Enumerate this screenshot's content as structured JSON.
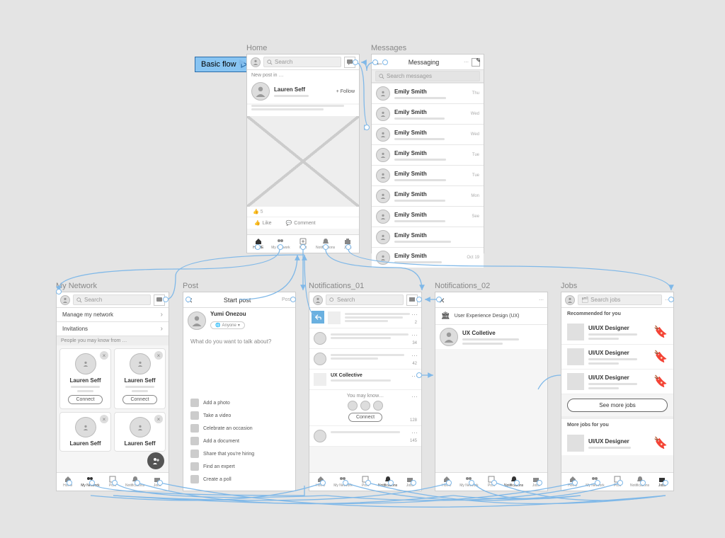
{
  "badge": {
    "label": "Basic flow"
  },
  "screens": {
    "home": {
      "title": "Home",
      "search": "Search",
      "newpost": "New post in …",
      "author": "Lauren Seff",
      "follow": "+ Follow",
      "likes": "5",
      "like": "Like",
      "comment": "Comment"
    },
    "messages": {
      "title": "Messages",
      "header": "Messaging",
      "search": "Search messages",
      "items": [
        {
          "name": "Emily Smith",
          "meta": "Thu"
        },
        {
          "name": "Emily Smith",
          "meta": "Wed"
        },
        {
          "name": "Emily Smith",
          "meta": "Wed"
        },
        {
          "name": "Emily Smith",
          "meta": "Tue"
        },
        {
          "name": "Emily Smith",
          "meta": "Tue"
        },
        {
          "name": "Emily Smith",
          "meta": "Mon"
        },
        {
          "name": "Emily Smith",
          "meta": "See"
        },
        {
          "name": "Emily Smith",
          "meta": ""
        },
        {
          "name": "Emily Smith",
          "meta": "Oct 19"
        }
      ]
    },
    "network": {
      "title": "My Network",
      "search": "Search",
      "manage": "Manage my network",
      "invitations": "Invitations",
      "pymk": "People you may know from …",
      "cards": [
        "Lauren Seff",
        "Lauren Seff",
        "Lauren Seff",
        "Lauren Seff"
      ],
      "connect": "Connect"
    },
    "post": {
      "title": "Post",
      "close": "×",
      "header": "Start post",
      "postBtn": "Post",
      "author": "Yumi Onezou",
      "audience": "Anyone",
      "prompt": "What do you want to talk about?",
      "actions": [
        "Add a photo",
        "Take a video",
        "Celebrate an occasion",
        "Add a document",
        "Share that you're hiring",
        "Find an expert",
        "Create a poll"
      ]
    },
    "notif1": {
      "title": "Notifications_01",
      "search": "Search",
      "uxcollective": "UX Collective",
      "pymk": "You may know…",
      "connect": "Connect",
      "counts": [
        "2",
        "34",
        "42",
        "",
        "128",
        "",
        "145"
      ]
    },
    "notif2": {
      "title": "Notifications_02",
      "category": "User Experience Design (UX)",
      "item": "UX Colletive"
    },
    "jobs": {
      "title": "Jobs",
      "search": "Search jobs",
      "recommended": "Recommended for you",
      "role": "UI/UX Designer",
      "seemore": "See more jobs",
      "more": "More jobs for you"
    }
  },
  "tabs": {
    "home": [
      "HOME",
      "My Network",
      "Post",
      "Notifications",
      "Jobs"
    ],
    "network": [
      "Home",
      "My Network",
      "Post",
      "Notifications",
      "Jobs"
    ],
    "notif": [
      "Home",
      "My Network",
      "Post",
      "Notifications",
      "Jobs"
    ],
    "jobs": [
      "Home",
      "My Network",
      "Post",
      "Notifications",
      "Jobs"
    ]
  }
}
